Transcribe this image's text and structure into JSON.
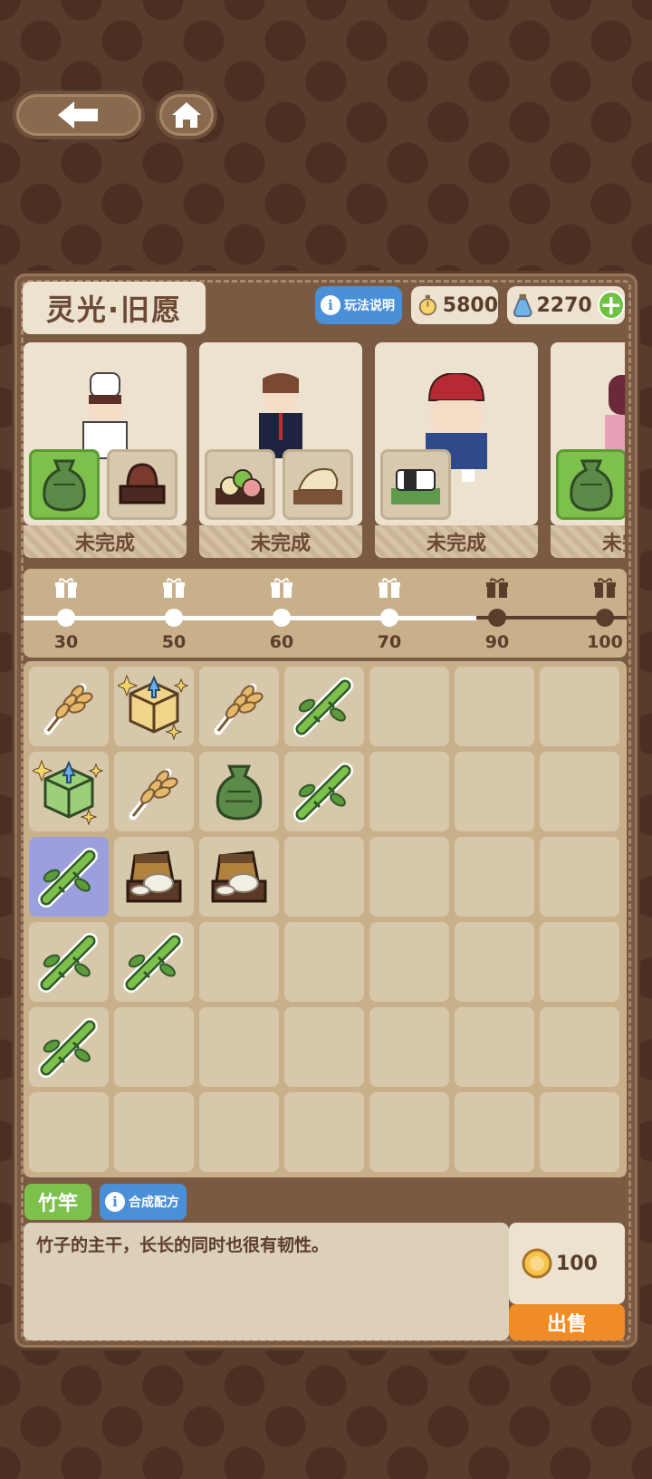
{
  "header": {
    "title": "灵光·旧愿"
  },
  "toolbar": {
    "rules_label": "玩法说明",
    "coins": "5800",
    "gems": "2270"
  },
  "orders": [
    {
      "character": "chef-girl",
      "status": "未完成",
      "needs": [
        {
          "item": "cloth-bag",
          "done": true
        },
        {
          "item": "red-bean-bowl",
          "done": false
        }
      ]
    },
    {
      "character": "boy-in-suit",
      "status": "未完成",
      "needs": [
        {
          "item": "dumplings-plate",
          "done": false
        },
        {
          "item": "noodles-plate",
          "done": false
        }
      ]
    },
    {
      "character": "red-cap-boy",
      "status": "未完成",
      "needs": [
        {
          "item": "sushi-plate",
          "done": false
        }
      ]
    },
    {
      "character": "girl",
      "status": "未完成",
      "needs": [
        {
          "item": "cloth-bag",
          "done": true
        }
      ]
    }
  ],
  "progress": {
    "reached_fraction": 0.75,
    "milestones": [
      {
        "value": "30",
        "reached": true
      },
      {
        "value": "50",
        "reached": true
      },
      {
        "value": "60",
        "reached": true
      },
      {
        "value": "70",
        "reached": true
      },
      {
        "value": "90",
        "reached": false
      },
      {
        "value": "100",
        "reached": false
      }
    ]
  },
  "inventory": [
    [
      "wheat",
      "box-yellow",
      "wheat",
      "bamboo",
      "",
      "",
      ""
    ],
    [
      "box-green",
      "wheat",
      "cloth-bag",
      "bamboo",
      "",
      "",
      ""
    ],
    [
      "bamboo",
      "flour-sack",
      "flour-sack",
      "",
      "",
      "",
      ""
    ],
    [
      "bamboo",
      "bamboo",
      "",
      "",
      "",
      "",
      ""
    ],
    [
      "bamboo",
      "",
      "",
      "",
      "",
      "",
      ""
    ],
    [
      "",
      "",
      "",
      "",
      "",
      "",
      ""
    ]
  ],
  "selected_cell": {
    "row": 2,
    "col": 0
  },
  "detail": {
    "name": "竹竿",
    "recipe_label": "合成配方",
    "description": "竹子的主干，长长的同时也很有韧性。",
    "price": "100",
    "sell_label": "出售"
  },
  "colors": {
    "done_green": "#7ec04c",
    "info_blue": "#4a90d9",
    "sell_orange": "#f08c28",
    "select_purple": "#9b9fdc"
  }
}
